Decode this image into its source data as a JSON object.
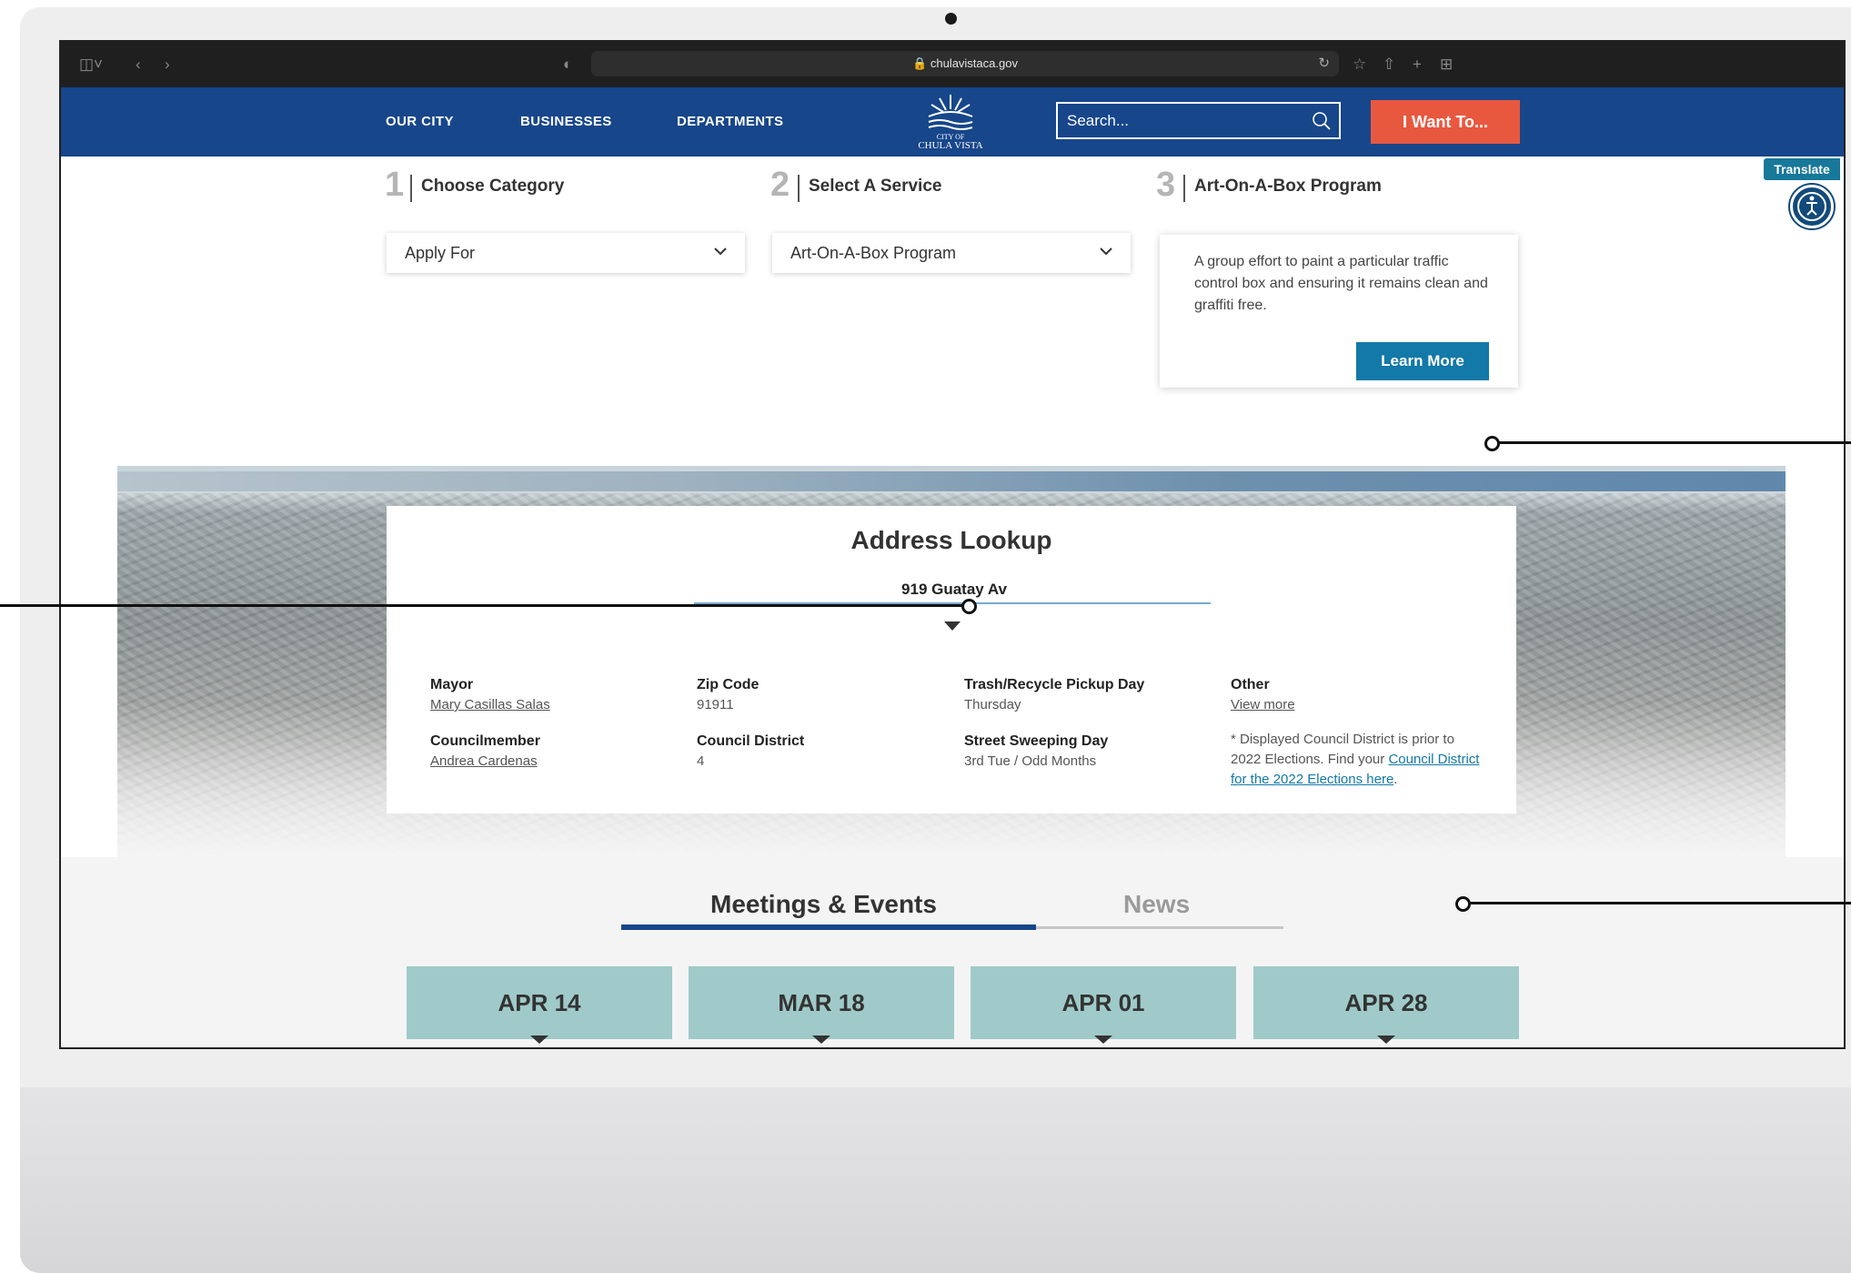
{
  "browser": {
    "url": "chulavistaca.gov"
  },
  "header": {
    "nav": [
      "OUR CITY",
      "BUSINESSES",
      "DEPARTMENTS"
    ],
    "logo_text_top": "CITY OF",
    "logo_text_bottom": "CHULA VISTA",
    "search_placeholder": "Search...",
    "cta_label": "I Want To..."
  },
  "translate_label": "Translate",
  "service_finder": {
    "steps": [
      {
        "number": "1",
        "label": "Choose Category"
      },
      {
        "number": "2",
        "label": "Select A Service"
      },
      {
        "number": "3",
        "label": "Art-On-A-Box Program"
      }
    ],
    "category_value": "Apply For",
    "service_value": "Art-On-A-Box Program",
    "description": "A group effort to paint a particular traffic control box and ensuring it remains clean and graffiti free.",
    "learn_more_label": "Learn More"
  },
  "address_lookup": {
    "title": "Address Lookup",
    "address_value": "919 Guatay Av",
    "fields": {
      "mayor_label": "Mayor",
      "mayor_value": "Mary Casillas Salas",
      "zip_label": "Zip Code",
      "zip_value": "91911",
      "trash_label": "Trash/Recycle Pickup Day",
      "trash_value": "Thursday",
      "other_label": "Other",
      "other_value": "View more",
      "council_label": "Councilmember",
      "council_value": "Andrea Cardenas",
      "district_label": "Council District",
      "district_value": "4",
      "sweep_label": "Street Sweeping Day",
      "sweep_value": "3rd Tue / Odd Months"
    },
    "note_prefix": "* Displayed Council District is prior to 2022 Elections. Find your ",
    "note_link": "Council District for the 2022 Elections here",
    "note_suffix": "."
  },
  "tabs": {
    "active": "Meetings & Events",
    "inactive": "News",
    "active_color": "#17468b"
  },
  "events": [
    "APR 14",
    "MAR 18",
    "APR 01",
    "APR 28"
  ],
  "colors": {
    "brand_blue": "#17468b",
    "cta_orange": "#e8583f",
    "button_blue": "#1279a8",
    "date_teal": "#9fcac9"
  }
}
